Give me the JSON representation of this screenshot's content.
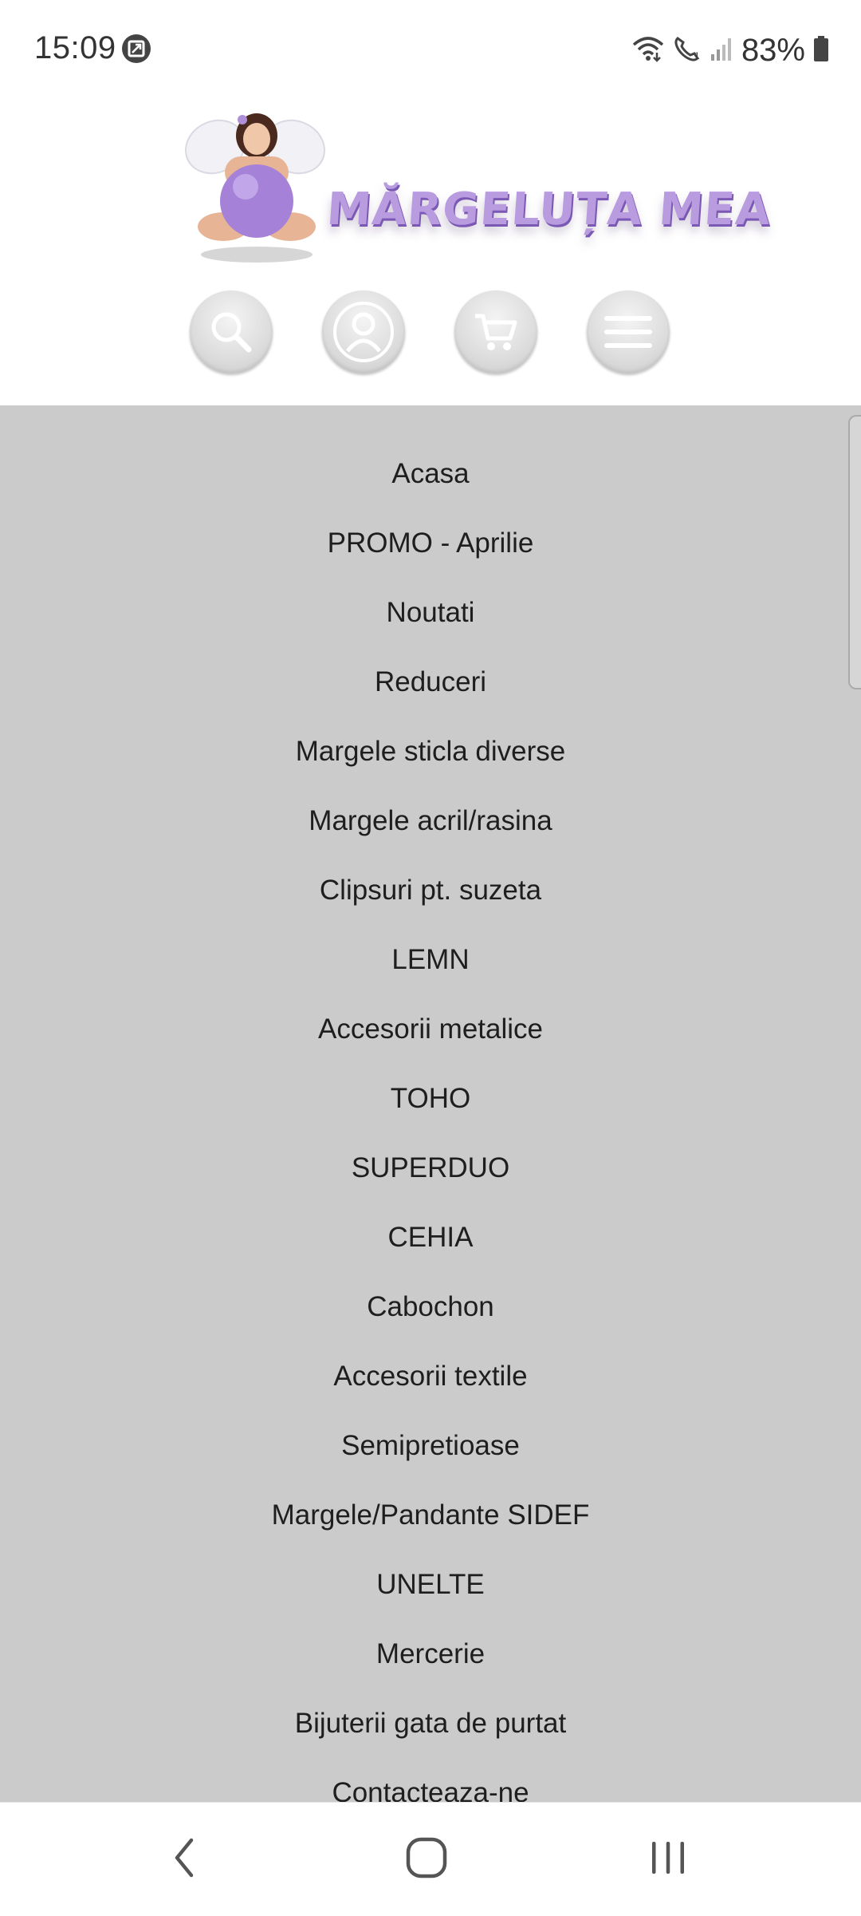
{
  "status_bar": {
    "time": "15:09",
    "battery": "83%",
    "icons": [
      "screenshot-icon",
      "wifi-calling-icon",
      "call-icon",
      "signal-icon",
      "battery-icon"
    ]
  },
  "header": {
    "logo_text": "MĂRGELUȚA MEA",
    "buttons": [
      {
        "name": "search-button",
        "icon": "search-icon"
      },
      {
        "name": "account-button",
        "icon": "user-icon"
      },
      {
        "name": "cart-button",
        "icon": "cart-icon"
      },
      {
        "name": "menu-button",
        "icon": "hamburger-icon"
      }
    ]
  },
  "menu": {
    "items": [
      "Acasa",
      "PROMO - Aprilie",
      "Noutati",
      "Reduceri",
      "Margele sticla diverse",
      "Margele acril/rasina",
      "Clipsuri pt. suzeta",
      "LEMN",
      "Accesorii metalice",
      "TOHO",
      "SUPERDUO",
      "CEHIA",
      "Cabochon",
      "Accesorii textile",
      "Semipretioase",
      "Margele/Pandante SIDEF",
      "UNELTE",
      "Mercerie",
      "Bijuterii gata de purtat",
      "Contacteaza-ne"
    ]
  },
  "colors": {
    "menu_background": "#cbcbcb",
    "logo_purple": "#b99be0"
  },
  "nav_bar": {
    "buttons": [
      "back-icon",
      "home-icon",
      "recents-icon"
    ]
  }
}
